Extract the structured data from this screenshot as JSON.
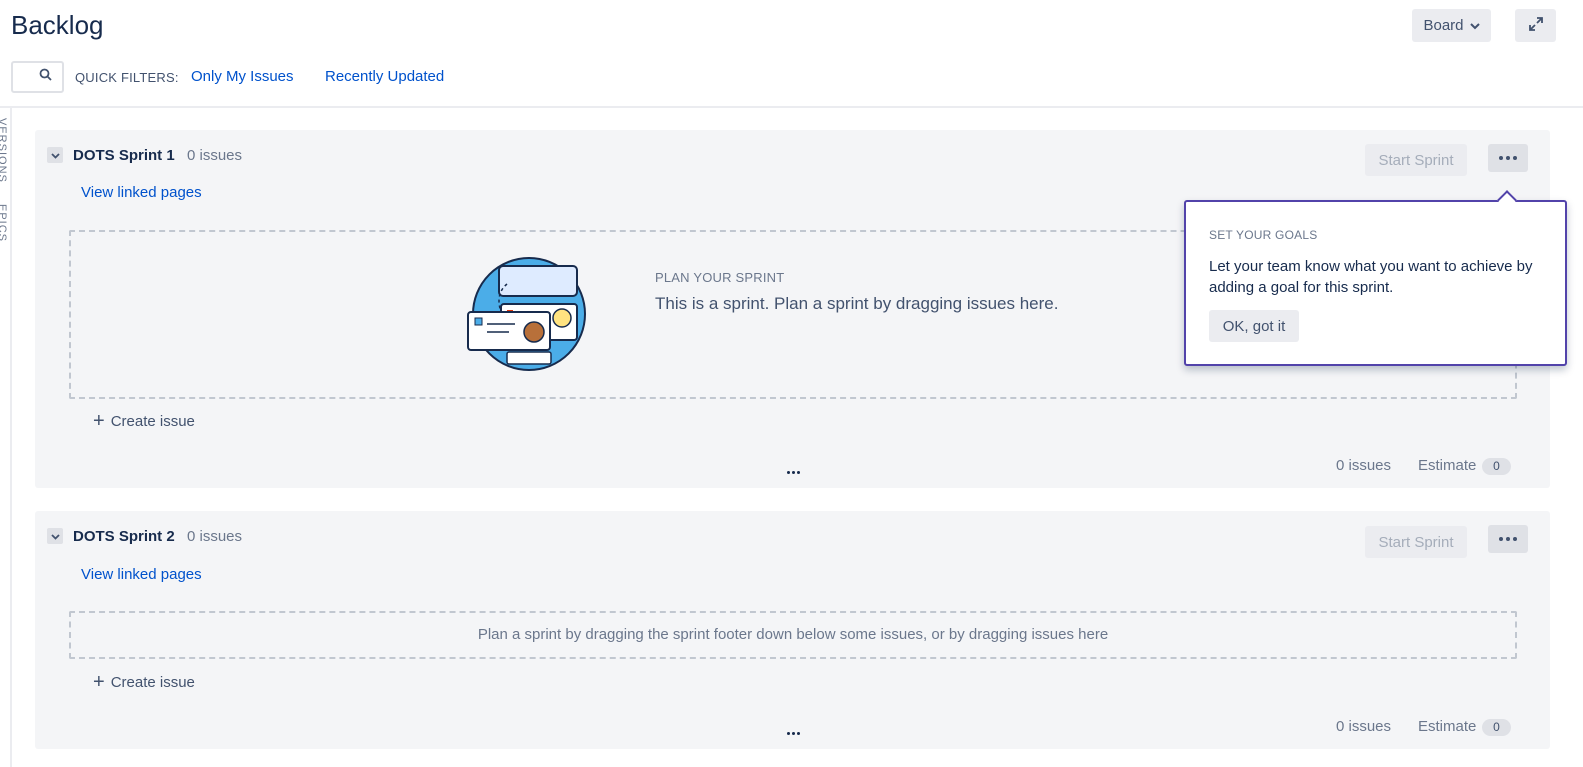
{
  "header": {
    "title": "Backlog",
    "board_label": "Board",
    "quick_filters_label": "QUICK FILTERS:",
    "filters": [
      "Only My Issues",
      "Recently Updated"
    ]
  },
  "side_tabs": [
    "VERSIONS",
    "EPICS"
  ],
  "sprints": [
    {
      "name": "DOTS Sprint 1",
      "count": "0 issues",
      "linked_pages": "View linked pages",
      "start_label": "Start Sprint",
      "plan_title": "PLAN YOUR SPRINT",
      "plan_text": "This is a sprint. Plan a sprint by dragging issues here.",
      "create_label": "Create issue",
      "footer_count": "0 issues",
      "estimate_label": "Estimate",
      "estimate_value": "0"
    },
    {
      "name": "DOTS Sprint 2",
      "count": "0 issues",
      "linked_pages": "View linked pages",
      "start_label": "Start Sprint",
      "drop_text": "Plan a sprint by dragging the sprint footer down below some issues, or by dragging issues here",
      "create_label": "Create issue",
      "footer_count": "0 issues",
      "estimate_label": "Estimate",
      "estimate_value": "0"
    }
  ],
  "popover": {
    "title": "SET YOUR GOALS",
    "body": "Let your team know what you want to achieve by adding a goal for this sprint.",
    "button": "OK, got it"
  },
  "colors": {
    "link": "#0052cc",
    "popover_border": "#5243aa",
    "sprint_bg": "#f4f5f7"
  },
  "icons": [
    "search-icon",
    "chevron-down-icon",
    "expand-icon",
    "more-icon",
    "plus-icon",
    "sprint-illustration"
  ]
}
